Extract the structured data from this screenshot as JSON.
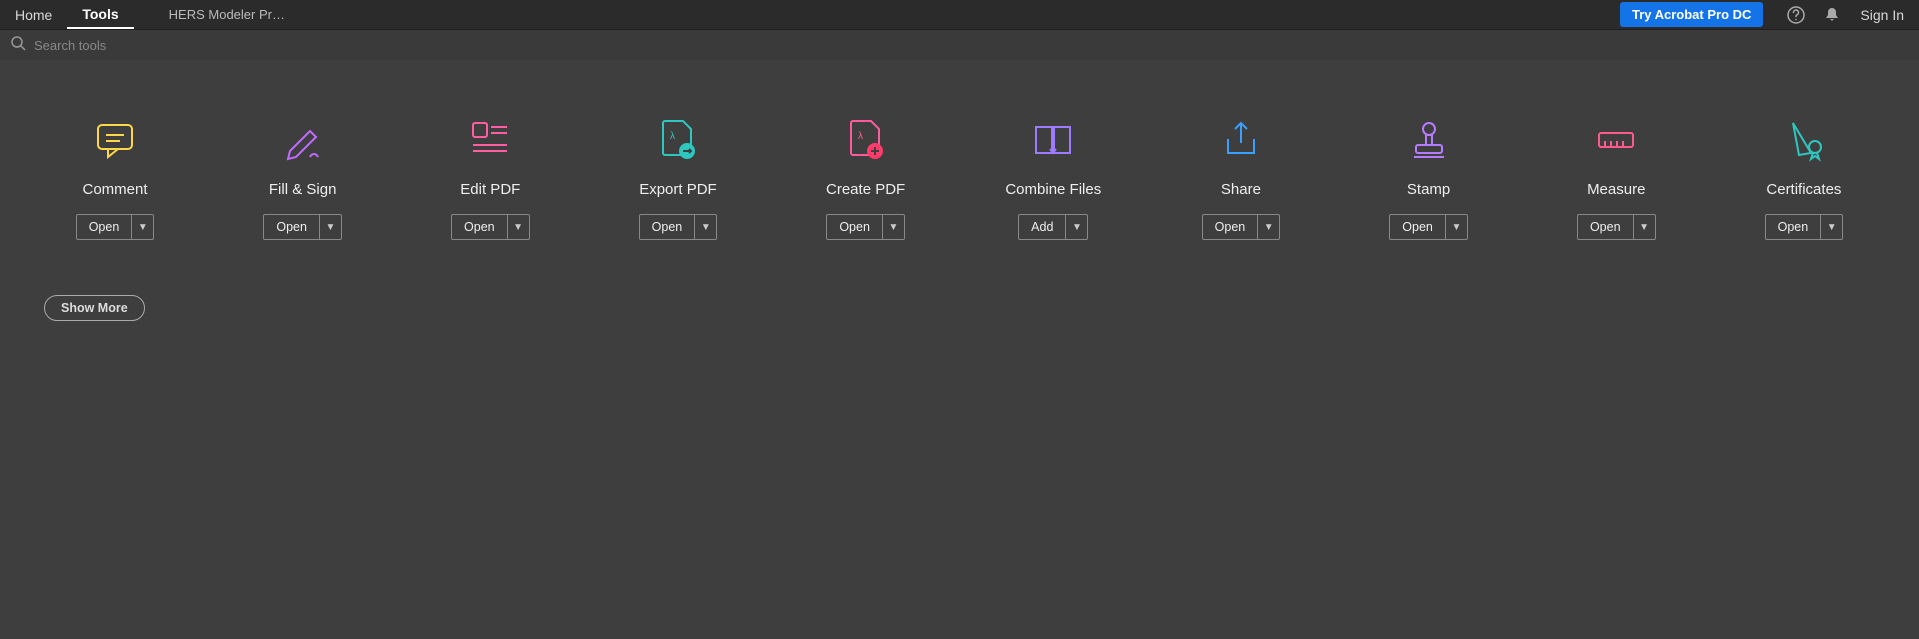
{
  "nav": {
    "home": "Home",
    "tools": "Tools",
    "doc_tab": "HERS Modeler Pr…"
  },
  "header": {
    "try_btn": "Try Acrobat Pro DC",
    "sign_in": "Sign In"
  },
  "search": {
    "placeholder": "Search tools"
  },
  "tools": [
    {
      "label": "Comment",
      "action": "Open",
      "icon_color": "#ffd54a"
    },
    {
      "label": "Fill & Sign",
      "action": "Open",
      "icon_color": "#c06bff"
    },
    {
      "label": "Edit PDF",
      "action": "Open",
      "icon_color": "#ff5fa2"
    },
    {
      "label": "Export PDF",
      "action": "Open",
      "icon_color": "#2ec7c0"
    },
    {
      "label": "Create PDF",
      "action": "Open",
      "icon_color": "#ff5a9e"
    },
    {
      "label": "Combine Files",
      "action": "Add",
      "icon_color": "#9d7bff"
    },
    {
      "label": "Share",
      "action": "Open",
      "icon_color": "#3aa0ff"
    },
    {
      "label": "Stamp",
      "action": "Open",
      "icon_color": "#b77bff"
    },
    {
      "label": "Measure",
      "action": "Open",
      "icon_color": "#ff5b8a"
    },
    {
      "label": "Certificates",
      "action": "Open",
      "icon_color": "#2ec7c0"
    }
  ],
  "show_more": "Show More"
}
